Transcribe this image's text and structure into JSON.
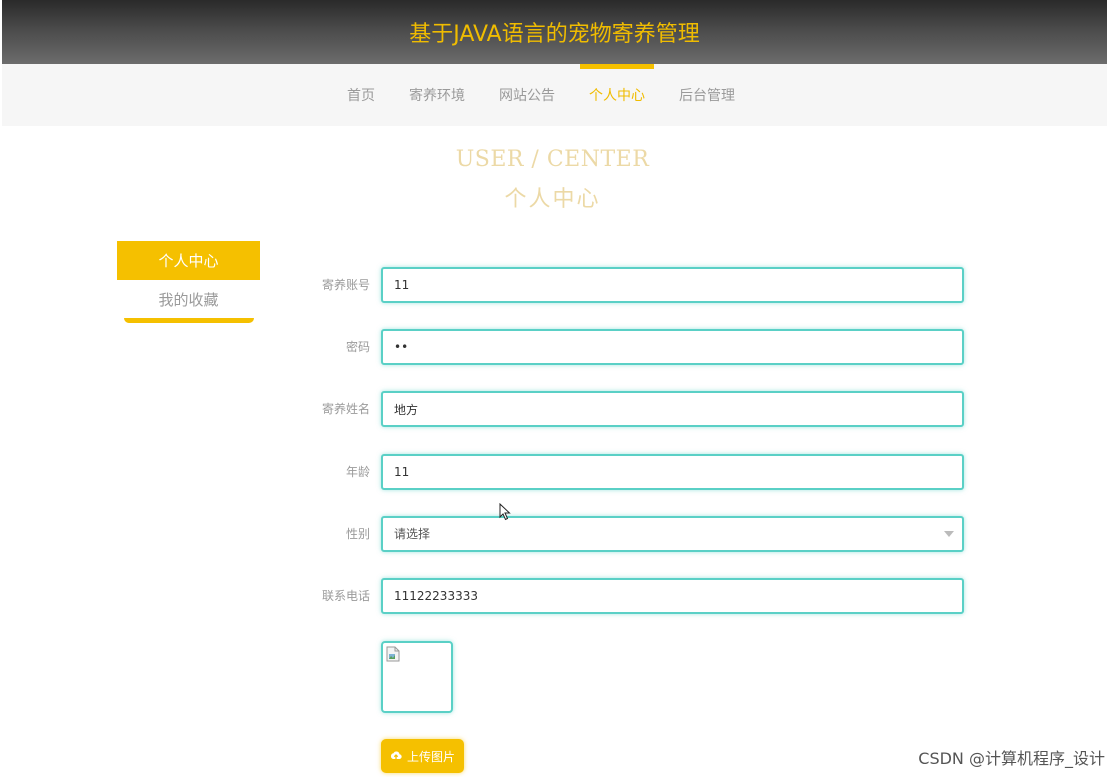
{
  "header": {
    "title": "基于JAVA语言的宠物寄养管理"
  },
  "nav": {
    "items": [
      {
        "label": "首页"
      },
      {
        "label": "寄养环境"
      },
      {
        "label": "网站公告"
      },
      {
        "label": "个人中心"
      },
      {
        "label": "后台管理"
      }
    ],
    "active_index": 3
  },
  "page_title": {
    "en": "USER / CENTER",
    "cn": "个人中心"
  },
  "side_menu": {
    "items": [
      {
        "label": "个人中心"
      },
      {
        "label": "我的收藏"
      }
    ],
    "active_index": 0
  },
  "form": {
    "account": {
      "label": "寄养账号",
      "value": "11"
    },
    "password": {
      "label": "密码",
      "value": "11"
    },
    "name": {
      "label": "寄养姓名",
      "value": "地方"
    },
    "age": {
      "label": "年龄",
      "value": "11"
    },
    "gender": {
      "label": "性别",
      "value": "请选择"
    },
    "phone": {
      "label": "联系电话",
      "value": "11122233333"
    }
  },
  "upload": {
    "button_label": "上传图片"
  },
  "watermark": {
    "text": "CSDN @计算机程序_设计"
  },
  "colors": {
    "accent": "#f5c000",
    "input_border": "#5ad0c6",
    "header_dark": "#2a2a2a",
    "muted_text": "#9a9a9a"
  },
  "icons": {
    "upload": "upload-cloud-icon",
    "broken_image": "broken-image-icon",
    "dropdown": "chevron-down-icon"
  }
}
